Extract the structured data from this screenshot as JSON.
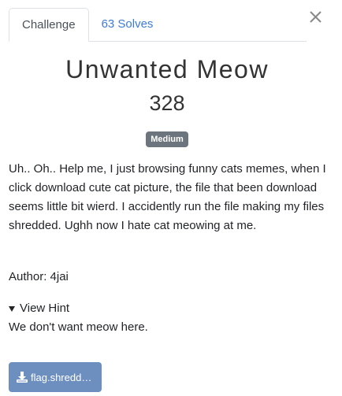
{
  "tabs": [
    {
      "label": "Challenge"
    },
    {
      "label": "63 Solves"
    }
  ],
  "challenge": {
    "name": "Unwanted Meow",
    "points": "328",
    "difficulty": "Medium",
    "description": "Uh.. Oh.. Help me, I just browsing funny cats memes, when I click download cute cat picture, the file that been download seems little bit wierd. I accidently run the file making my files shredded. Ughh now I hate cat meowing at me.",
    "author": "Author: 4jai"
  },
  "hint": {
    "summary": "View Hint",
    "body": "We don't want meow here."
  },
  "file": {
    "label": "flag.shredd…"
  },
  "colors": {
    "link": "#3e7bd6",
    "badge": "#6c757d",
    "file_button": "#6d8fbf"
  }
}
